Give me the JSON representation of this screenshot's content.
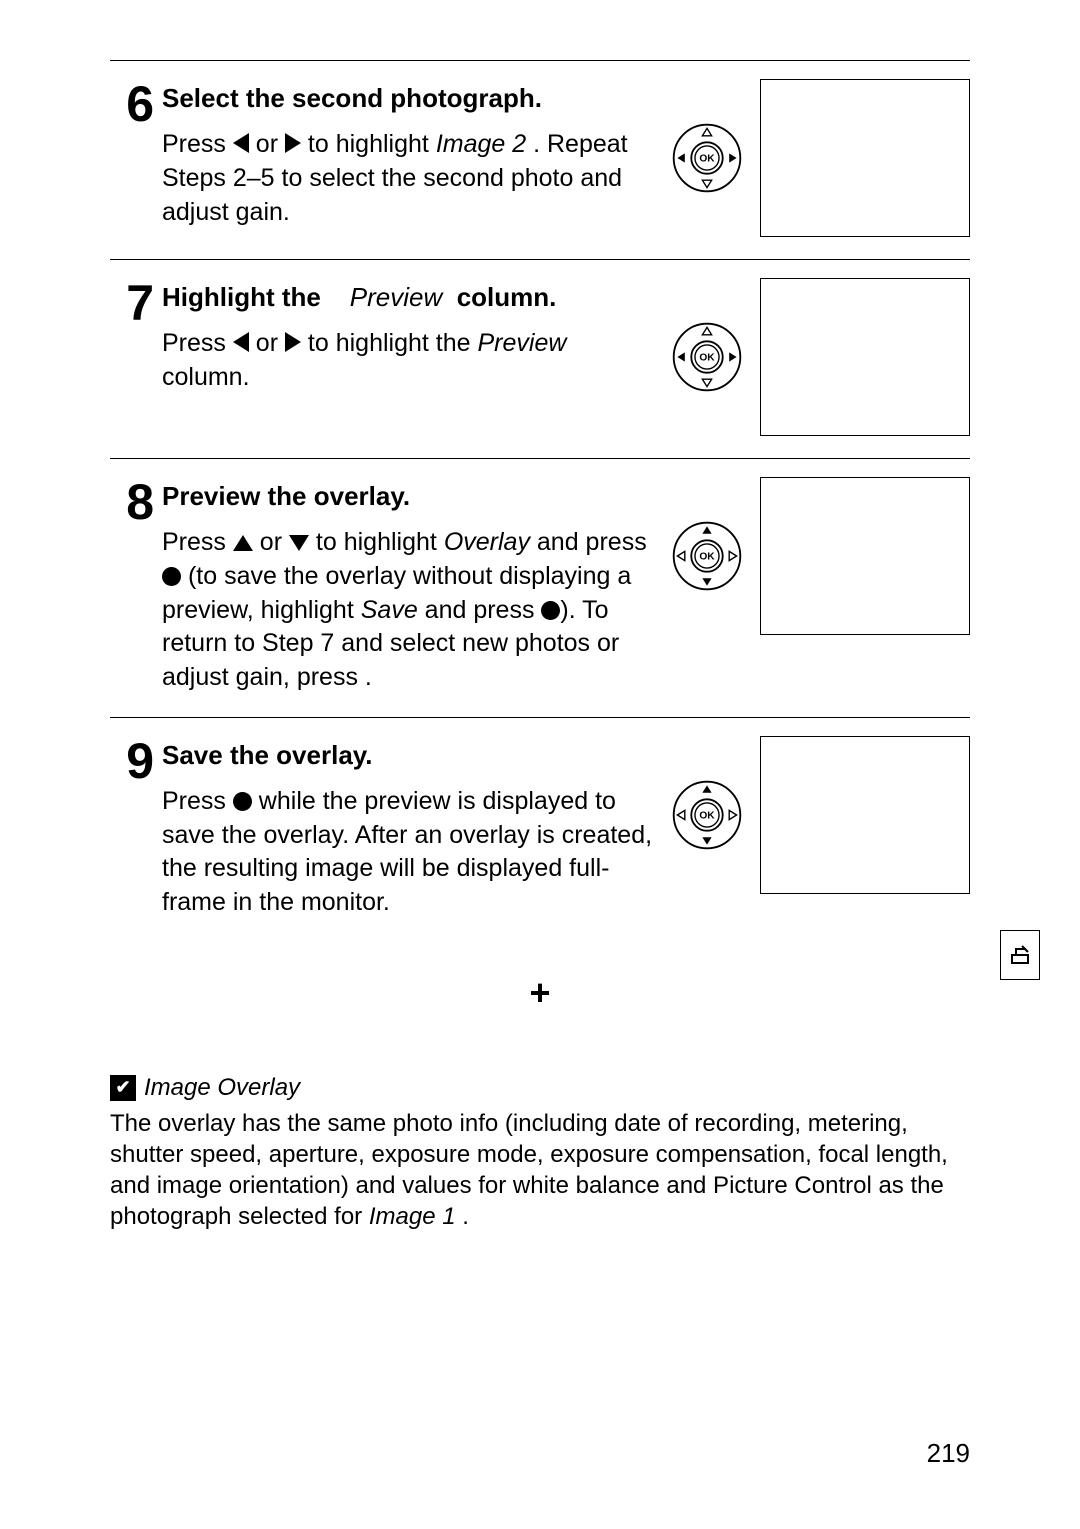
{
  "steps": [
    {
      "num": "6",
      "title_pre": "Select the second photograph.",
      "body": {
        "t1": "Press ",
        "t2": " or ",
        "t3": " to highlight ",
        "i1": "Image 2",
        "t4": " .  Repeat Steps 2–5 to select the second photo and adjust gain."
      },
      "selector": "lr_filled"
    },
    {
      "num": "7",
      "title_parts": {
        "a": "Highlight the",
        "b": "Preview",
        "c": "column."
      },
      "body": {
        "t1": "Press ",
        "t2": " or ",
        "t3": " to highlight the ",
        "i1": "Preview",
        "t4": "  column."
      },
      "selector": "lr_filled"
    },
    {
      "num": "8",
      "title_pre": "Preview the overlay.",
      "body": {
        "t1": "Press ",
        "t2": " or ",
        "t3": " to highlight ",
        "i1": "Overlay",
        "t4": "  and press ",
        "t5": " (to save the overlay without displaying a preview, highlight ",
        "i2": "Save",
        "t6": "  and press ",
        "t7": ").  To return to Step 7 and select new photos or adjust gain, press     ."
      },
      "selector": "ud_open"
    },
    {
      "num": "9",
      "title_pre": "Save the overlay.",
      "body": {
        "t1": "Press ",
        "t2": " while the preview is displayed to save the overlay.  After an overlay is created, the resulting image will be displayed full-frame in the monitor."
      },
      "selector": "ud_open"
    }
  ],
  "plus": "+",
  "note": {
    "title": "Image Overlay",
    "body_a": "The overlay has the same photo info (including date of recording, metering, shutter speed, aperture, exposure mode, exposure compensation, focal length, and image orientation) and values for white balance and Picture Control as the photograph selected for ",
    "body_i": "Image 1",
    "body_b": " ."
  },
  "pagenum": "219"
}
